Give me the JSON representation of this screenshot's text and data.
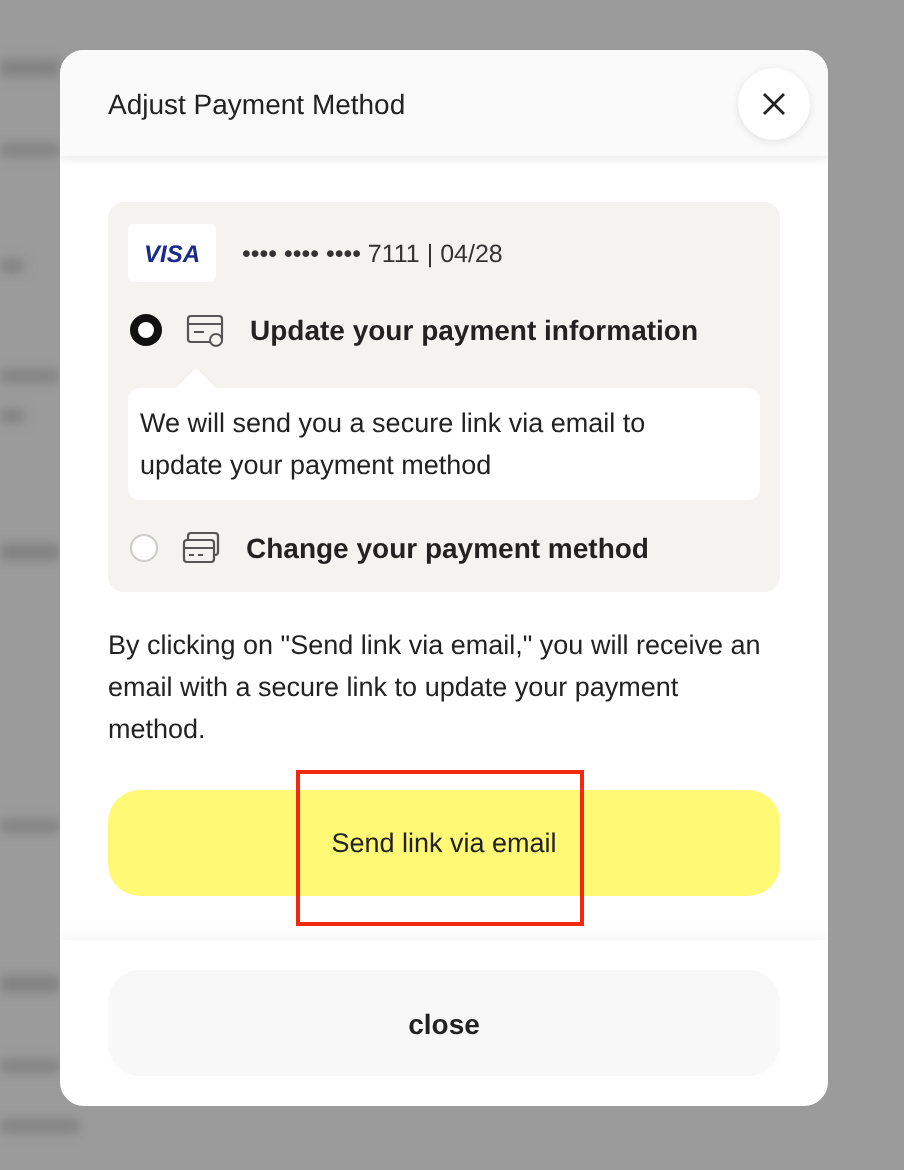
{
  "dialog": {
    "title": "Adjust Payment Method"
  },
  "card": {
    "brand": "VISA",
    "number": "•••• •••• •••• 7111 | 04/28"
  },
  "options": [
    {
      "kind": "update",
      "label": "Update your payment information",
      "selected": true,
      "description": "We will send you a secure link via email to update your payment method"
    },
    {
      "kind": "change",
      "label": "Change your payment method",
      "selected": false
    }
  ],
  "notice": "By clicking on \"Send link via email,\" you will receive an email with a secure link to update your payment method.",
  "primary_button": "Send link via email",
  "footer_button": "close"
}
